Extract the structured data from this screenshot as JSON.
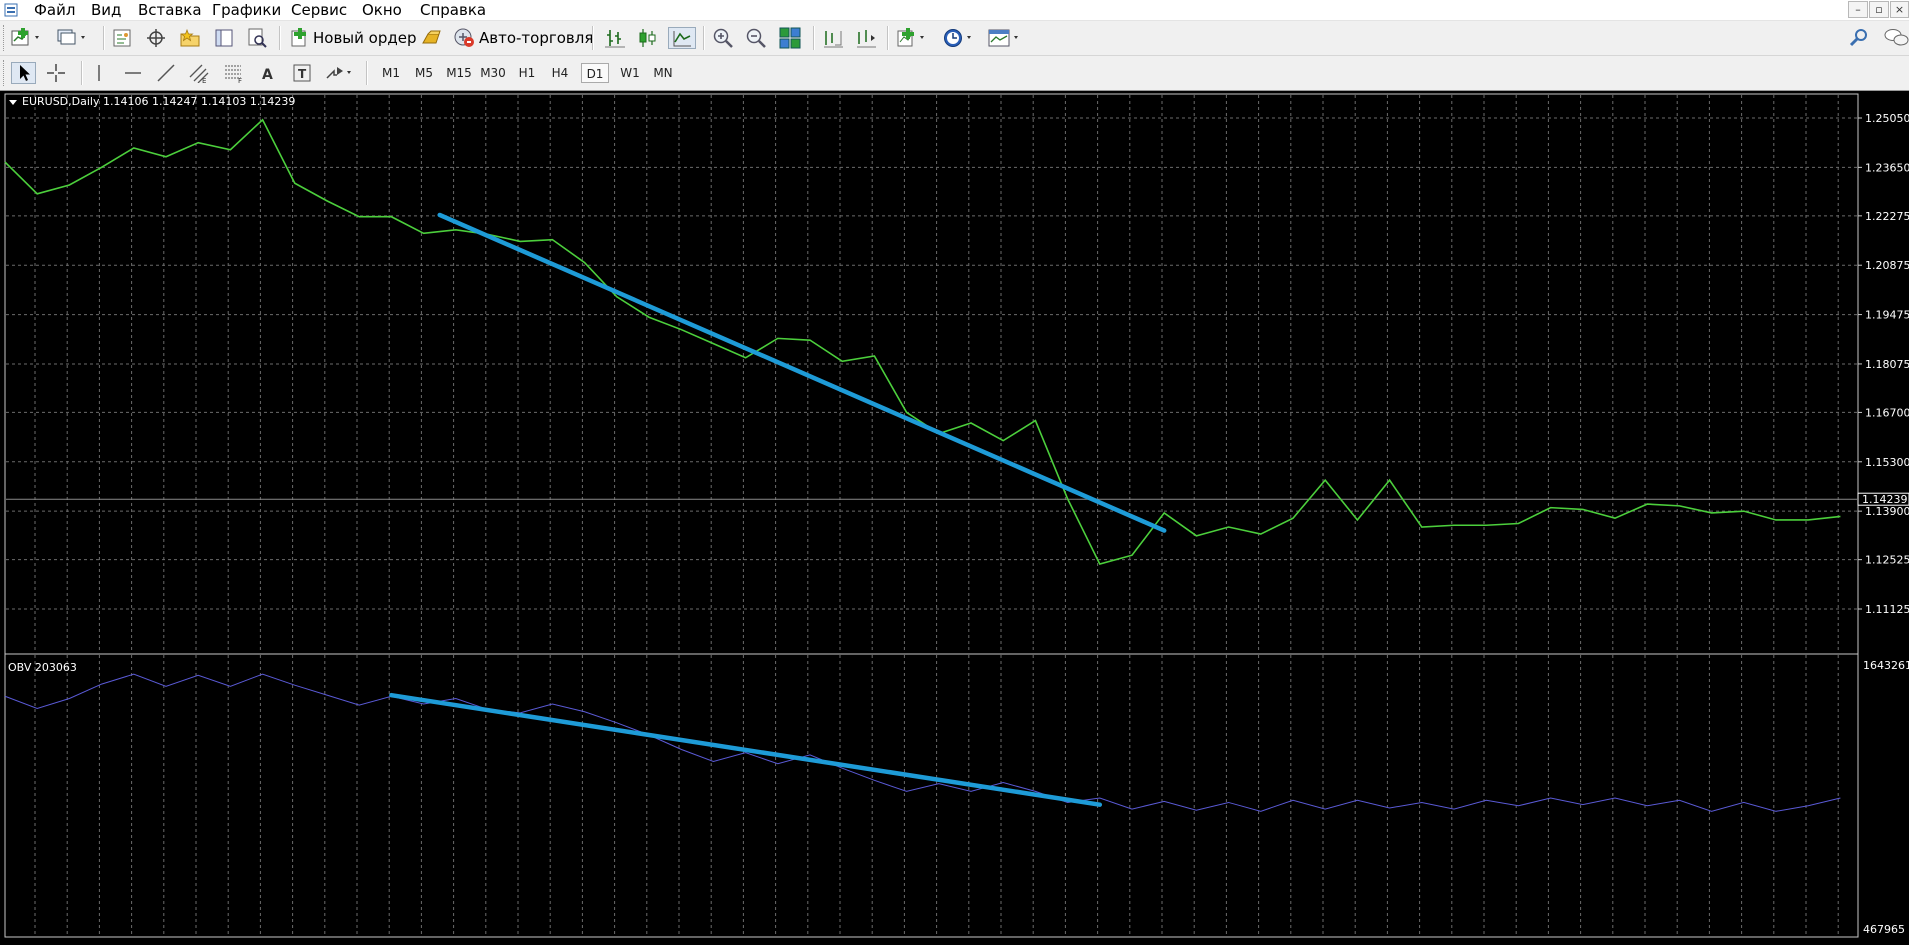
{
  "menu": [
    "Файл",
    "Вид",
    "Вставка",
    "Графики",
    "Сервис",
    "Окно",
    "Справка"
  ],
  "window_controls": [
    "–",
    "▫",
    "×"
  ],
  "toolbar": {
    "new_order_label": "Новый ордер",
    "auto_trading_label": "Авто-торговля"
  },
  "timeframes": [
    "M1",
    "M5",
    "M15",
    "M30",
    "H1",
    "H4",
    "D1",
    "W1",
    "MN"
  ],
  "active_timeframe": "D1",
  "chart": {
    "header": "EURUSD,Daily  1.14106 1.14247 1.14103 1.14239",
    "current_price_label": "1.14239",
    "price_color": "#4ccf3c",
    "trendline_color": "#1e9bd7",
    "obv_color": "#5a5ad6"
  },
  "indicator": {
    "header": "OBV 203063",
    "scale_top": "1643261",
    "scale_bottom": "467965"
  },
  "chart_data": [
    {
      "type": "line",
      "title": "EURUSD,Daily  1.14106 1.14247 1.14103 1.14239",
      "series": [
        {
          "values": [
            1.238,
            1.229,
            1.2315,
            1.2365,
            1.242,
            1.2395,
            1.2435,
            1.2415,
            1.25,
            1.232,
            1.227,
            1.2225,
            1.2225,
            1.2178,
            1.2188,
            1.2175,
            1.2155,
            1.216,
            1.2095,
            1.1998,
            1.194,
            1.1905,
            1.1865,
            1.1825,
            1.188,
            1.1875,
            1.1815,
            1.183,
            1.167,
            1.161,
            1.164,
            1.159,
            1.1647,
            1.1425,
            1.124,
            1.1265,
            1.1385,
            1.132,
            1.1345,
            1.1325,
            1.137,
            1.1478,
            1.1365,
            1.1478,
            1.1345,
            1.135,
            1.135,
            1.1355,
            1.14,
            1.1395,
            1.137,
            1.141,
            1.1405,
            1.1385,
            1.139,
            1.1365,
            1.1365,
            1.1375
          ]
        }
      ],
      "y_ticks": [
        "1.25050",
        "1.23650",
        "1.22275",
        "1.20875",
        "1.19475",
        "1.18075",
        "1.16700",
        "1.15300",
        "1.13900",
        "1.12525",
        "1.11125"
      ],
      "ylim": [
        1.11125,
        1.2505
      ],
      "trendline": {
        "from": [
          13.5,
          1.223
        ],
        "to": [
          36,
          1.1335
        ]
      },
      "current_price": 1.14239,
      "grid": true
    },
    {
      "type": "line",
      "title": "OBV 203063",
      "series": [
        {
          "values": [
            1520000,
            1465000,
            1510000,
            1575000,
            1620000,
            1565000,
            1615000,
            1565000,
            1620000,
            1570000,
            1525000,
            1480000,
            1520000,
            1485000,
            1510000,
            1460000,
            1445000,
            1485000,
            1450000,
            1400000,
            1345000,
            1280000,
            1225000,
            1265000,
            1215000,
            1255000,
            1195000,
            1140000,
            1090000,
            1125000,
            1090000,
            1130000,
            1090000,
            1040000,
            1060000,
            1010000,
            1045000,
            1005000,
            1040000,
            1000000,
            1050000,
            1010000,
            1050000,
            1015000,
            1040000,
            1010000,
            1050000,
            1025000,
            1060000,
            1030000,
            1060000,
            1025000,
            1050000,
            1000000,
            1040000,
            1000000,
            1025000,
            1060000
          ]
        }
      ],
      "y_ticks": [
        "1643261",
        "467965"
      ],
      "ylim": [
        467965,
        1643261
      ],
      "trendline": {
        "from": [
          12,
          1525000
        ],
        "to": [
          34,
          1030000
        ]
      },
      "grid": true
    }
  ]
}
